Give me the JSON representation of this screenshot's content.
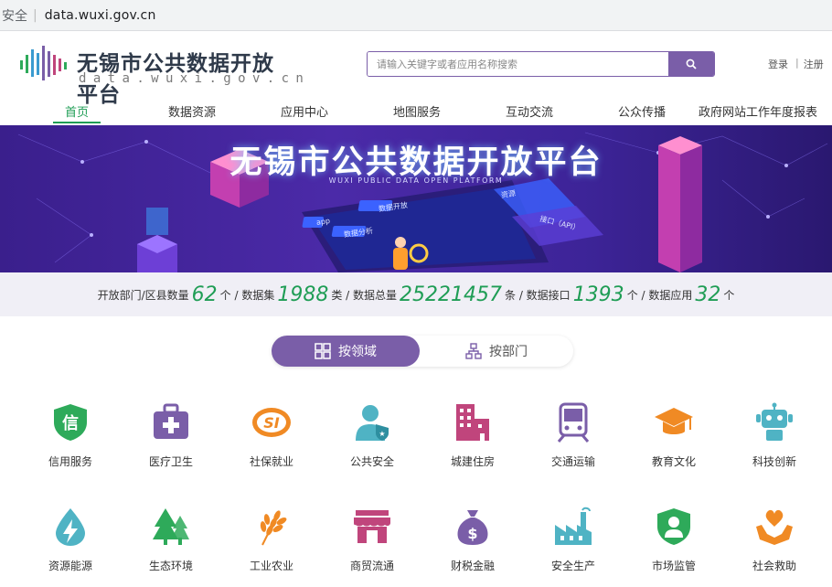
{
  "browser": {
    "secure_label": "安全",
    "url": "data.wuxi.gov.cn"
  },
  "header": {
    "logo_title": "无锡市公共数据开放平台",
    "logo_subtitle": "data.wuxi.gov.cn",
    "search_placeholder": "请输入关键字或者应用名称搜索",
    "login": "登录",
    "register": "注册"
  },
  "nav": {
    "items": [
      "首页",
      "数据资源",
      "应用中心",
      "地图服务",
      "互动交流",
      "公众传播",
      "政府网站工作年度报表"
    ],
    "active_index": 0
  },
  "banner": {
    "title": "无锡市公共数据开放平台",
    "subtitle": "WUXI PUBLIC DATA OPEN PLATFORM",
    "tags": [
      "数据开放",
      "数据分析",
      "app",
      "接口（API）",
      "资源"
    ]
  },
  "stats": {
    "dept_label": "开放部门/区县数量",
    "dept_value": "62",
    "dept_unit": "个 / 数据集",
    "dataset_value": "1988",
    "dataset_unit": "类 / 数据总量",
    "total_value": "25221457",
    "total_unit": "条 / 数据接口",
    "api_value": "1393",
    "api_unit": "个 / 数据应用",
    "app_value": "32",
    "app_unit": "个"
  },
  "toggle": {
    "by_domain": "按领域",
    "by_department": "按部门"
  },
  "categories": [
    {
      "label": "信用服务",
      "icon": "credit-shield-icon",
      "color": "#2eaa5a"
    },
    {
      "label": "医疗卫生",
      "icon": "medical-kit-icon",
      "color": "#7a5ea8"
    },
    {
      "label": "社保就业",
      "icon": "social-security-icon",
      "color": "#f08a24"
    },
    {
      "label": "公共安全",
      "icon": "police-officer-icon",
      "color": "#4fb3c4"
    },
    {
      "label": "城建住房",
      "icon": "buildings-icon",
      "color": "#c0457c"
    },
    {
      "label": "交通运输",
      "icon": "train-icon",
      "color": "#7a5ea8"
    },
    {
      "label": "教育文化",
      "icon": "graduation-cap-icon",
      "color": "#f08a24"
    },
    {
      "label": "科技创新",
      "icon": "robot-icon",
      "color": "#4fb3c4"
    },
    {
      "label": "资源能源",
      "icon": "energy-drop-icon",
      "color": "#4fb3c4"
    },
    {
      "label": "生态环境",
      "icon": "trees-icon",
      "color": "#2eaa5a"
    },
    {
      "label": "工业农业",
      "icon": "wheat-icon",
      "color": "#f08a24"
    },
    {
      "label": "商贸流通",
      "icon": "shop-icon",
      "color": "#c0457c"
    },
    {
      "label": "财税金融",
      "icon": "money-bag-icon",
      "color": "#7a5ea8"
    },
    {
      "label": "安全生产",
      "icon": "factory-icon",
      "color": "#4fb3c4"
    },
    {
      "label": "市场监管",
      "icon": "inspector-shield-icon",
      "color": "#2eaa5a"
    },
    {
      "label": "社会救助",
      "icon": "helping-hands-icon",
      "color": "#f08a24"
    }
  ]
}
